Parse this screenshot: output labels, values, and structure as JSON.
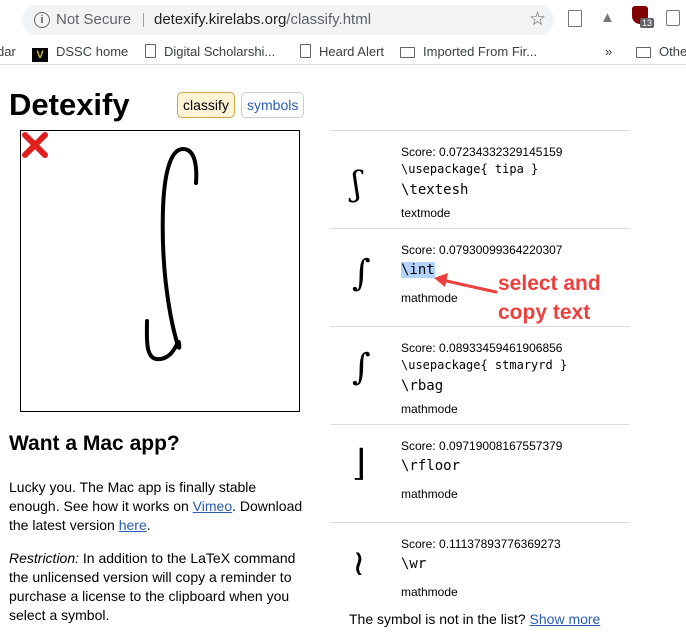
{
  "browser": {
    "security_label": "Not Secure",
    "url_host": "detexify.kirelabs.org",
    "url_path": "/classify.html",
    "extension_badge": "13",
    "bookmarks": [
      {
        "label": "dar"
      },
      {
        "label": "DSSC home"
      },
      {
        "label": "Digital Scholarshi..."
      },
      {
        "label": "Heard Alert"
      },
      {
        "label": "Imported From Fir..."
      },
      {
        "label": "»"
      },
      {
        "label": "Othe"
      }
    ]
  },
  "page": {
    "title": "Detexify",
    "nav": {
      "classify": "classify",
      "symbols": "symbols"
    }
  },
  "mac": {
    "heading": "Want a Mac app?",
    "p1_text": "Lucky you. The Mac app is finally stable enough. See how it works on ",
    "p1_link1": "Vimeo",
    "p1_mid": ". Download the latest version ",
    "p1_link2": "here",
    "p1_end": ".",
    "p2_em": "Restriction:",
    "p2_text": " In addition to the LaTeX command the unlicensed version will copy a reminder to purchase a license to the clipboard when you select a symbol."
  },
  "results": [
    {
      "glyph": "ʃ",
      "score": "Score: 0.07234332329145159",
      "package": "\\usepackage{ tipa }",
      "command": "\\textesh",
      "mode": "textmode"
    },
    {
      "glyph": "∫",
      "score": "Score: 0.07930099364220307",
      "package": "",
      "command": "\\int",
      "mode": "mathmode"
    },
    {
      "glyph": "∫",
      "score": "Score: 0.08933459461906856",
      "package": "\\usepackage{ stmaryrd }",
      "command": "\\rbag",
      "mode": "mathmode"
    },
    {
      "glyph": "⌋",
      "score": "Score: 0.09719008167557379",
      "package": "",
      "command": "\\rfloor",
      "mode": "mathmode"
    },
    {
      "glyph": "≀",
      "score": "Score: 0.11137893776369273",
      "package": "",
      "command": "\\wr",
      "mode": "mathmode"
    }
  ],
  "footer": {
    "not_in_list": "The symbol is not in the list? ",
    "show_more": "Show more"
  },
  "annotation": {
    "line1": "select and",
    "line2": "copy text",
    "color": "#ee3f3f"
  }
}
